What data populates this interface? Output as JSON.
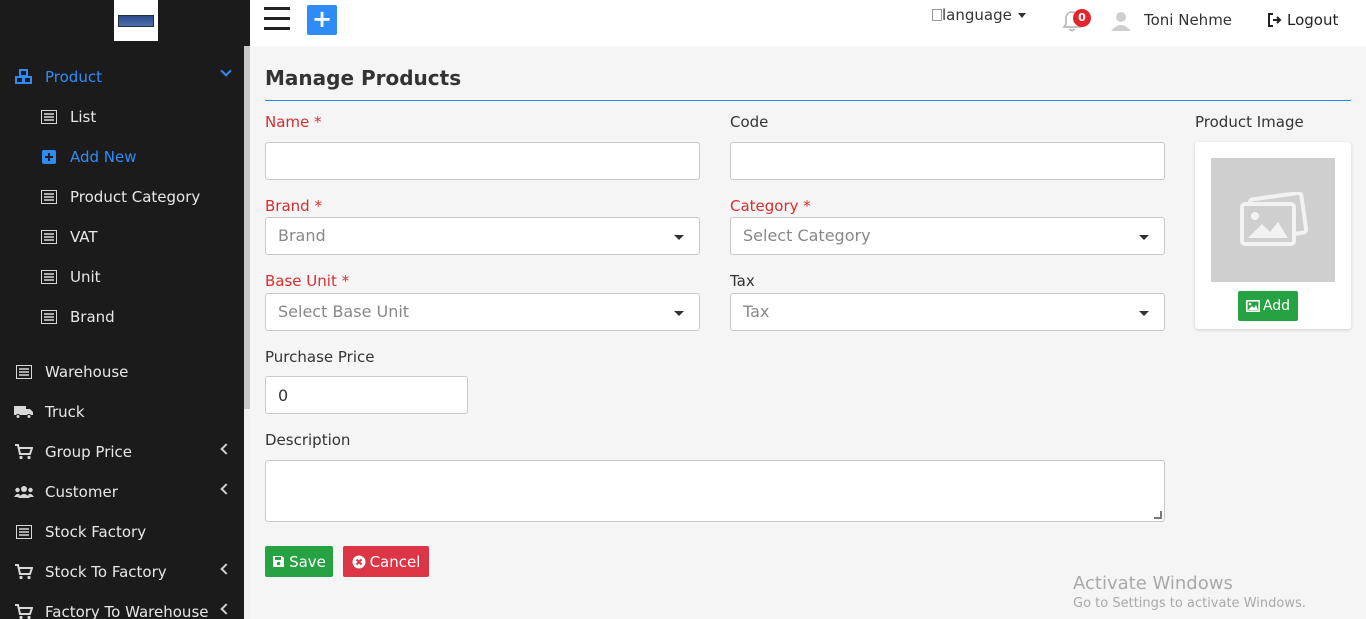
{
  "topbar": {
    "language_alt": "language",
    "notification_count": "0",
    "user_name": "Toni Nehme",
    "logout_label": "Logout"
  },
  "sidebar": {
    "product_label": "Product",
    "product_sub": [
      {
        "label": "List",
        "icon": "list-icon"
      },
      {
        "label": "Add New",
        "icon": "plus-square-icon",
        "active": true
      },
      {
        "label": "Product Category",
        "icon": "list-icon"
      },
      {
        "label": "VAT",
        "icon": "list-icon"
      },
      {
        "label": "Unit",
        "icon": "list-icon"
      },
      {
        "label": "Brand",
        "icon": "list-icon"
      }
    ],
    "items": [
      {
        "label": "Warehouse",
        "icon": "list-icon"
      },
      {
        "label": "Truck",
        "icon": "truck-icon"
      },
      {
        "label": "Group Price",
        "icon": "cart-icon"
      },
      {
        "label": "Customer",
        "icon": "users-icon"
      },
      {
        "label": "Stock Factory",
        "icon": "list-icon"
      },
      {
        "label": "Stock To Factory",
        "icon": "cart-icon"
      },
      {
        "label": "Factory To Warehouse",
        "icon": "cart-icon"
      }
    ]
  },
  "page": {
    "title": "Manage Products"
  },
  "form": {
    "name_label": "Name *",
    "name_value": "",
    "code_label": "Code",
    "code_value": "",
    "brand_label": "Brand *",
    "brand_placeholder": "Brand",
    "category_label": "Category *",
    "category_placeholder": "Select Category",
    "base_unit_label": "Base Unit *",
    "base_unit_placeholder": "Select Base Unit",
    "tax_label": "Tax",
    "tax_placeholder": "Tax",
    "purchase_price_label": "Purchase Price",
    "purchase_price_value": "0",
    "description_label": "Description",
    "description_value": "",
    "product_image_label": "Product Image",
    "add_image_label": "Add",
    "save_label": "Save",
    "cancel_label": "Cancel"
  },
  "watermark": {
    "line1": "Activate Windows",
    "line2": "Go to Settings to activate Windows."
  },
  "colors": {
    "accent": "#2f8cf6",
    "sidebar_bg": "#1b1b1b",
    "required": "#d62f2f",
    "success": "#27a243",
    "danger": "#dc3545"
  }
}
